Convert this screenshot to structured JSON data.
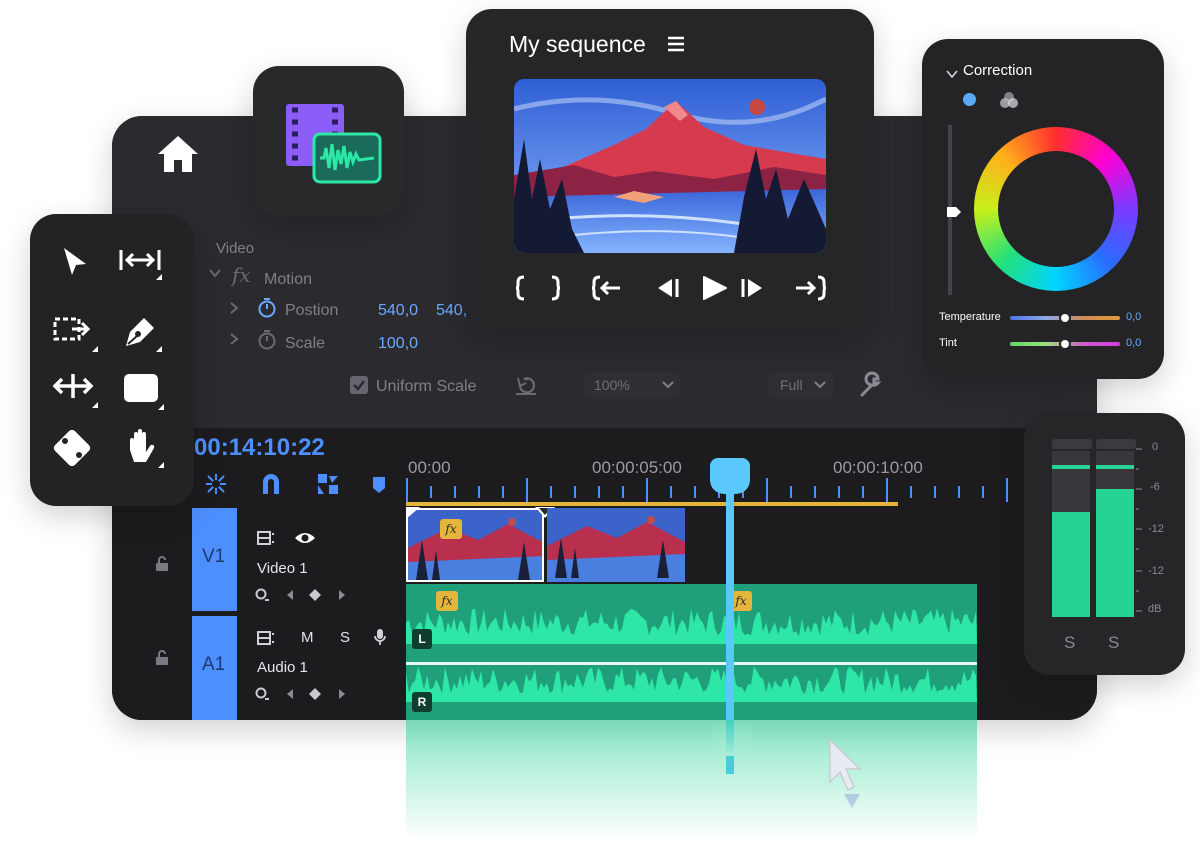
{
  "monitor": {
    "title": "My sequence"
  },
  "effects": {
    "section": "Video",
    "motion": "Motion",
    "position_label": "Postion",
    "position_x": "540,0",
    "position_y": "540,",
    "scale_label": "Scale",
    "scale_value": "100,0",
    "uniform_scale": "Uniform Scale",
    "zoom": "100%",
    "quality": "Full"
  },
  "timeline": {
    "timecode": "00:14:10:22",
    "ruler": [
      "00:00",
      "00:00:05:00",
      "00:00:10:00"
    ],
    "tracks": {
      "v1": {
        "tag": "V1",
        "name": "Video 1"
      },
      "a1": {
        "tag": "A1",
        "name": "Audio 1",
        "mute": "M",
        "solo": "S"
      }
    },
    "fx_badge": "fx",
    "channel_left": "L",
    "channel_right": "R"
  },
  "color_panel": {
    "title": "Correction",
    "temperature_label": "Temperature",
    "temperature_value": "0,0",
    "temperature_level": 0.5,
    "tint_label": "Tint",
    "tint_value": "0,0",
    "tint_level": 0.5
  },
  "meter": {
    "scale": [
      "0",
      "-6",
      "-12",
      "-12",
      "dB"
    ],
    "solo_left": "S",
    "solo_right": "S",
    "level_left": 0.63,
    "level_right": 0.77
  },
  "colors": {
    "accent_blue": "#4d8fff",
    "playhead": "#5ac8fa",
    "audio_green": "#27d394",
    "fx_yellow": "#e3b53b"
  }
}
